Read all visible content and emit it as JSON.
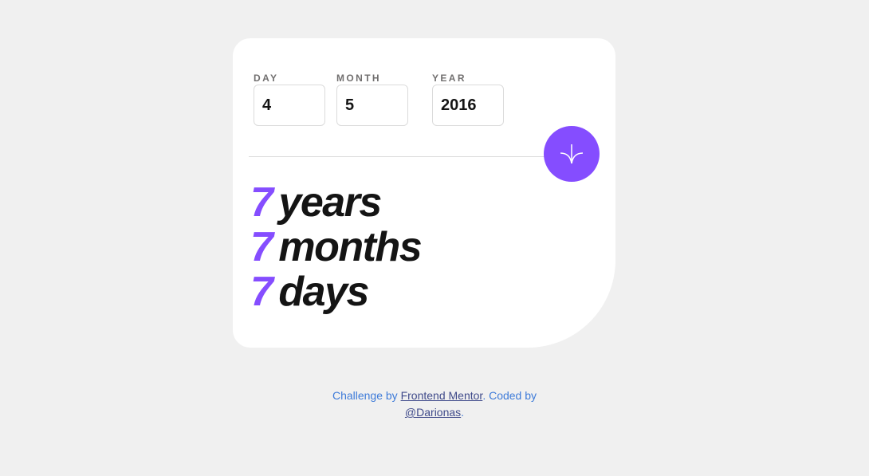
{
  "form": {
    "day": {
      "label": "DAY",
      "value": "4"
    },
    "month": {
      "label": "MONTH",
      "value": "5"
    },
    "year": {
      "label": "YEAR",
      "value": "2016"
    }
  },
  "results": {
    "years": {
      "value": "7",
      "unit": "years"
    },
    "months": {
      "value": "7",
      "unit": "months"
    },
    "days": {
      "value": "7",
      "unit": "days"
    }
  },
  "submit_button": {
    "icon": "arrow-down-icon"
  },
  "footer": {
    "prefix": "Challenge by ",
    "link1": "Frontend Mentor",
    "middle": ". Coded by ",
    "link2": "@Darionas",
    "suffix": "."
  },
  "colors": {
    "accent": "#854dff",
    "background": "#f0f0f0",
    "card": "#ffffff",
    "text": "#141414",
    "label": "#716f6f",
    "footer_text": "#3e7bd9",
    "footer_link": "#3f4a8a"
  }
}
